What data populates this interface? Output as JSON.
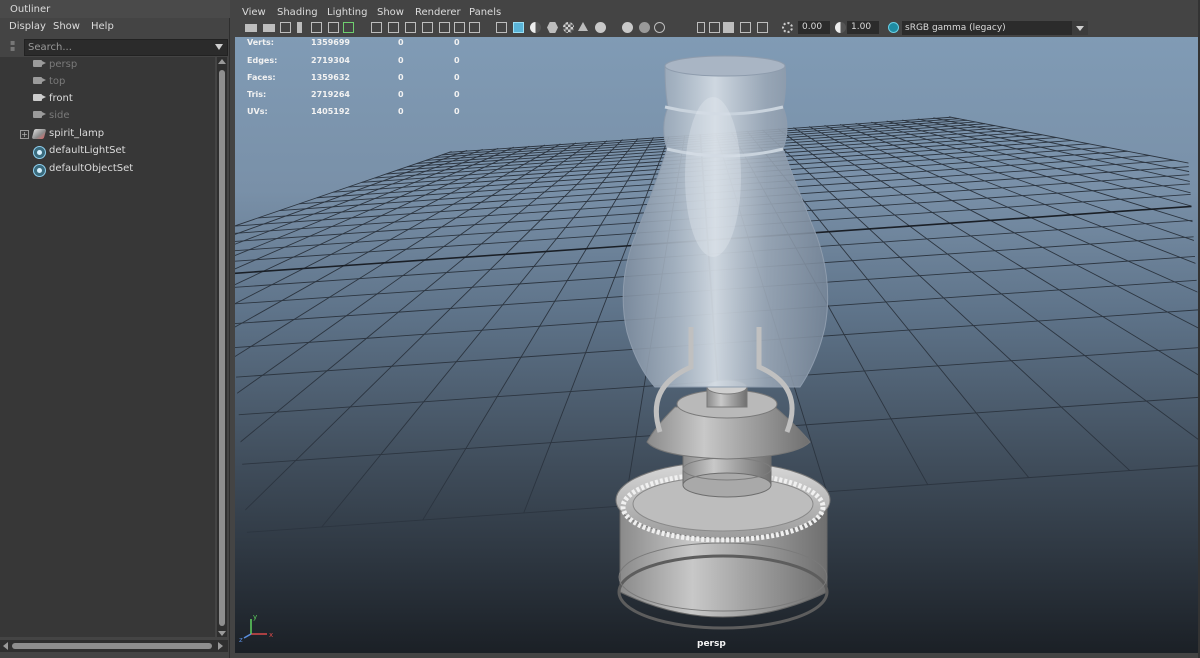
{
  "outliner": {
    "title": "Outliner",
    "menu": [
      "Display",
      "Show",
      "Help"
    ],
    "search_placeholder": "Search...",
    "items": [
      {
        "label": "persp",
        "type": "camera",
        "state": "hidden"
      },
      {
        "label": "top",
        "type": "camera",
        "state": "hidden"
      },
      {
        "label": "front",
        "type": "camera",
        "state": "visible"
      },
      {
        "label": "side",
        "type": "camera",
        "state": "hidden"
      },
      {
        "label": "spirit_lamp",
        "type": "mesh-group",
        "state": "visible",
        "expandable": true
      },
      {
        "label": "defaultLightSet",
        "type": "set",
        "state": "visible"
      },
      {
        "label": "defaultObjectSet",
        "type": "set",
        "state": "visible"
      }
    ]
  },
  "panel": {
    "menu": [
      "View",
      "Shading",
      "Lighting",
      "Show",
      "Renderer",
      "Panels"
    ],
    "toolbar": {
      "exposure": "0.00",
      "gamma": "1.00",
      "color_space": "sRGB gamma (legacy)"
    }
  },
  "hud": {
    "rows": [
      {
        "label": "Verts:",
        "values": [
          "1359699",
          "0",
          "0"
        ]
      },
      {
        "label": "Edges:",
        "values": [
          "2719304",
          "0",
          "0"
        ]
      },
      {
        "label": "Faces:",
        "values": [
          "1359632",
          "0",
          "0"
        ]
      },
      {
        "label": "Tris:",
        "values": [
          "2719264",
          "0",
          "0"
        ]
      },
      {
        "label": "UVs:",
        "values": [
          "1405192",
          "0",
          "0"
        ]
      }
    ]
  },
  "viewport": {
    "camera": "persp",
    "axis_labels": {
      "x": "x",
      "y": "y",
      "z": "z"
    }
  },
  "colors": {
    "background_top": "#809bb5",
    "background_bottom": "#1b2026",
    "accent": "#5ab4d8",
    "ui_panel": "#444444"
  }
}
